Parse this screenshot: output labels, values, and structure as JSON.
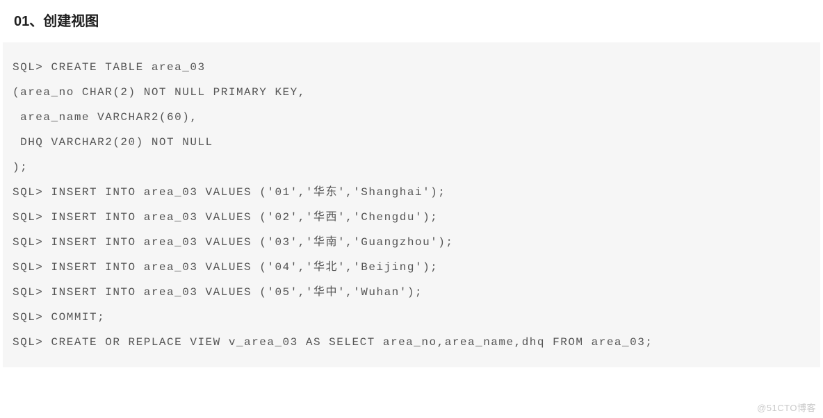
{
  "heading": "01、创建视图",
  "code": {
    "lines": [
      "SQL> CREATE TABLE area_03",
      "(area_no CHAR(2) NOT NULL PRIMARY KEY,",
      " area_name VARCHAR2(60),",
      " DHQ VARCHAR2(20) NOT NULL",
      ");",
      "",
      "SQL> INSERT INTO area_03 VALUES ('01','华东','Shanghai');",
      "SQL> INSERT INTO area_03 VALUES ('02','华西','Chengdu');",
      "SQL> INSERT INTO area_03 VALUES ('03','华南','Guangzhou');",
      "SQL> INSERT INTO area_03 VALUES ('04','华北','Beijing');",
      "SQL> INSERT INTO area_03 VALUES ('05','华中','Wuhan');",
      "SQL> COMMIT;",
      "",
      "SQL> CREATE OR REPLACE VIEW v_area_03 AS SELECT area_no,area_name,dhq FROM area_03;"
    ]
  },
  "watermark": "@51CTO博客"
}
